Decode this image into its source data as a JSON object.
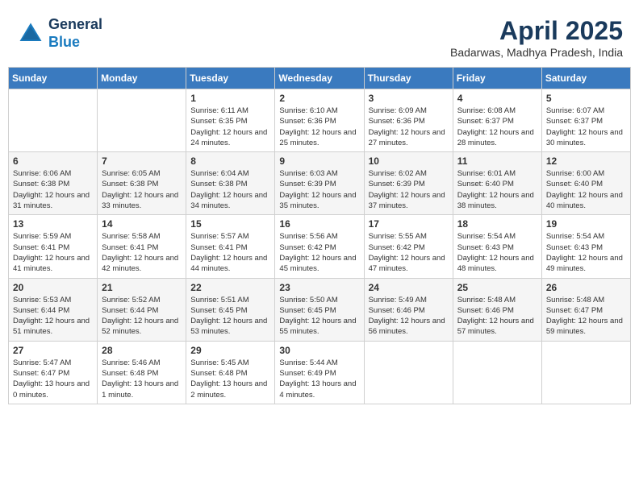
{
  "header": {
    "logo_line1": "General",
    "logo_line2": "Blue",
    "month_title": "April 2025",
    "location": "Badarwas, Madhya Pradesh, India"
  },
  "days_of_week": [
    "Sunday",
    "Monday",
    "Tuesday",
    "Wednesday",
    "Thursday",
    "Friday",
    "Saturday"
  ],
  "weeks": [
    [
      {
        "day": "",
        "sunrise": "",
        "sunset": "",
        "daylight": ""
      },
      {
        "day": "",
        "sunrise": "",
        "sunset": "",
        "daylight": ""
      },
      {
        "day": "1",
        "sunrise": "Sunrise: 6:11 AM",
        "sunset": "Sunset: 6:35 PM",
        "daylight": "Daylight: 12 hours and 24 minutes."
      },
      {
        "day": "2",
        "sunrise": "Sunrise: 6:10 AM",
        "sunset": "Sunset: 6:36 PM",
        "daylight": "Daylight: 12 hours and 25 minutes."
      },
      {
        "day": "3",
        "sunrise": "Sunrise: 6:09 AM",
        "sunset": "Sunset: 6:36 PM",
        "daylight": "Daylight: 12 hours and 27 minutes."
      },
      {
        "day": "4",
        "sunrise": "Sunrise: 6:08 AM",
        "sunset": "Sunset: 6:37 PM",
        "daylight": "Daylight: 12 hours and 28 minutes."
      },
      {
        "day": "5",
        "sunrise": "Sunrise: 6:07 AM",
        "sunset": "Sunset: 6:37 PM",
        "daylight": "Daylight: 12 hours and 30 minutes."
      }
    ],
    [
      {
        "day": "6",
        "sunrise": "Sunrise: 6:06 AM",
        "sunset": "Sunset: 6:38 PM",
        "daylight": "Daylight: 12 hours and 31 minutes."
      },
      {
        "day": "7",
        "sunrise": "Sunrise: 6:05 AM",
        "sunset": "Sunset: 6:38 PM",
        "daylight": "Daylight: 12 hours and 33 minutes."
      },
      {
        "day": "8",
        "sunrise": "Sunrise: 6:04 AM",
        "sunset": "Sunset: 6:38 PM",
        "daylight": "Daylight: 12 hours and 34 minutes."
      },
      {
        "day": "9",
        "sunrise": "Sunrise: 6:03 AM",
        "sunset": "Sunset: 6:39 PM",
        "daylight": "Daylight: 12 hours and 35 minutes."
      },
      {
        "day": "10",
        "sunrise": "Sunrise: 6:02 AM",
        "sunset": "Sunset: 6:39 PM",
        "daylight": "Daylight: 12 hours and 37 minutes."
      },
      {
        "day": "11",
        "sunrise": "Sunrise: 6:01 AM",
        "sunset": "Sunset: 6:40 PM",
        "daylight": "Daylight: 12 hours and 38 minutes."
      },
      {
        "day": "12",
        "sunrise": "Sunrise: 6:00 AM",
        "sunset": "Sunset: 6:40 PM",
        "daylight": "Daylight: 12 hours and 40 minutes."
      }
    ],
    [
      {
        "day": "13",
        "sunrise": "Sunrise: 5:59 AM",
        "sunset": "Sunset: 6:41 PM",
        "daylight": "Daylight: 12 hours and 41 minutes."
      },
      {
        "day": "14",
        "sunrise": "Sunrise: 5:58 AM",
        "sunset": "Sunset: 6:41 PM",
        "daylight": "Daylight: 12 hours and 42 minutes."
      },
      {
        "day": "15",
        "sunrise": "Sunrise: 5:57 AM",
        "sunset": "Sunset: 6:41 PM",
        "daylight": "Daylight: 12 hours and 44 minutes."
      },
      {
        "day": "16",
        "sunrise": "Sunrise: 5:56 AM",
        "sunset": "Sunset: 6:42 PM",
        "daylight": "Daylight: 12 hours and 45 minutes."
      },
      {
        "day": "17",
        "sunrise": "Sunrise: 5:55 AM",
        "sunset": "Sunset: 6:42 PM",
        "daylight": "Daylight: 12 hours and 47 minutes."
      },
      {
        "day": "18",
        "sunrise": "Sunrise: 5:54 AM",
        "sunset": "Sunset: 6:43 PM",
        "daylight": "Daylight: 12 hours and 48 minutes."
      },
      {
        "day": "19",
        "sunrise": "Sunrise: 5:54 AM",
        "sunset": "Sunset: 6:43 PM",
        "daylight": "Daylight: 12 hours and 49 minutes."
      }
    ],
    [
      {
        "day": "20",
        "sunrise": "Sunrise: 5:53 AM",
        "sunset": "Sunset: 6:44 PM",
        "daylight": "Daylight: 12 hours and 51 minutes."
      },
      {
        "day": "21",
        "sunrise": "Sunrise: 5:52 AM",
        "sunset": "Sunset: 6:44 PM",
        "daylight": "Daylight: 12 hours and 52 minutes."
      },
      {
        "day": "22",
        "sunrise": "Sunrise: 5:51 AM",
        "sunset": "Sunset: 6:45 PM",
        "daylight": "Daylight: 12 hours and 53 minutes."
      },
      {
        "day": "23",
        "sunrise": "Sunrise: 5:50 AM",
        "sunset": "Sunset: 6:45 PM",
        "daylight": "Daylight: 12 hours and 55 minutes."
      },
      {
        "day": "24",
        "sunrise": "Sunrise: 5:49 AM",
        "sunset": "Sunset: 6:46 PM",
        "daylight": "Daylight: 12 hours and 56 minutes."
      },
      {
        "day": "25",
        "sunrise": "Sunrise: 5:48 AM",
        "sunset": "Sunset: 6:46 PM",
        "daylight": "Daylight: 12 hours and 57 minutes."
      },
      {
        "day": "26",
        "sunrise": "Sunrise: 5:48 AM",
        "sunset": "Sunset: 6:47 PM",
        "daylight": "Daylight: 12 hours and 59 minutes."
      }
    ],
    [
      {
        "day": "27",
        "sunrise": "Sunrise: 5:47 AM",
        "sunset": "Sunset: 6:47 PM",
        "daylight": "Daylight: 13 hours and 0 minutes."
      },
      {
        "day": "28",
        "sunrise": "Sunrise: 5:46 AM",
        "sunset": "Sunset: 6:48 PM",
        "daylight": "Daylight: 13 hours and 1 minute."
      },
      {
        "day": "29",
        "sunrise": "Sunrise: 5:45 AM",
        "sunset": "Sunset: 6:48 PM",
        "daylight": "Daylight: 13 hours and 2 minutes."
      },
      {
        "day": "30",
        "sunrise": "Sunrise: 5:44 AM",
        "sunset": "Sunset: 6:49 PM",
        "daylight": "Daylight: 13 hours and 4 minutes."
      },
      {
        "day": "",
        "sunrise": "",
        "sunset": "",
        "daylight": ""
      },
      {
        "day": "",
        "sunrise": "",
        "sunset": "",
        "daylight": ""
      },
      {
        "day": "",
        "sunrise": "",
        "sunset": "",
        "daylight": ""
      }
    ]
  ]
}
